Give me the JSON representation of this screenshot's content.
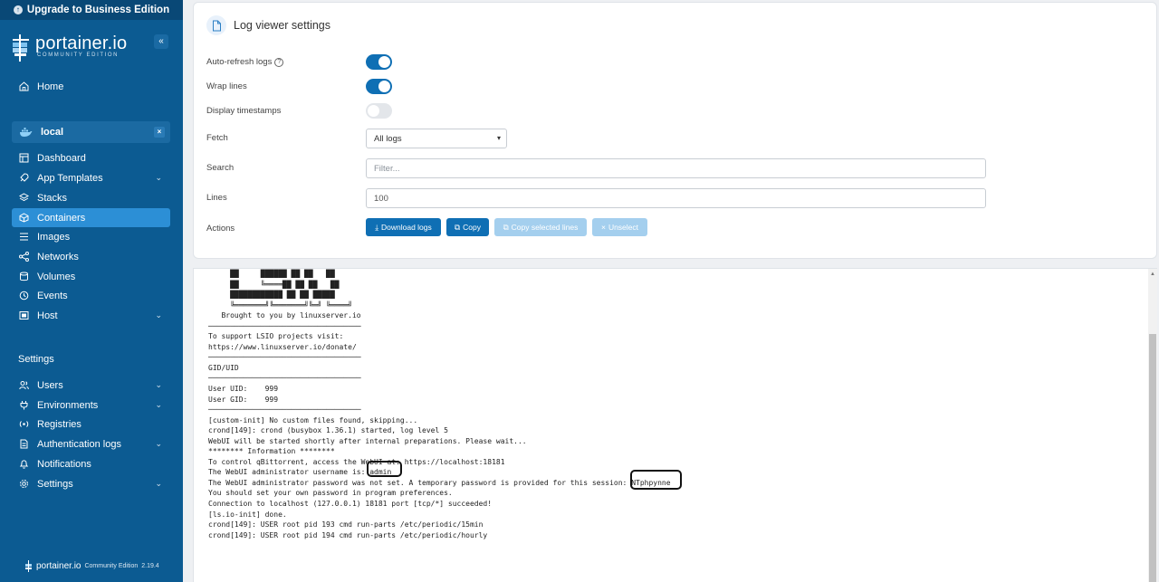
{
  "upgrade": {
    "label": "Upgrade to Business Edition"
  },
  "brand": {
    "name": "portainer.io",
    "edition": "COMMUNITY EDITION",
    "collapse_glyph": "«"
  },
  "nav": {
    "home": "Home",
    "environment": "local",
    "env_close": "×",
    "items": [
      {
        "label": "Dashboard",
        "icon": "dashboard-icon"
      },
      {
        "label": "App Templates",
        "icon": "rocket-icon"
      },
      {
        "label": "Stacks",
        "icon": "stack-icon"
      },
      {
        "label": "Containers",
        "icon": "box-icon"
      },
      {
        "label": "Images",
        "icon": "list-icon"
      },
      {
        "label": "Networks",
        "icon": "network-icon"
      },
      {
        "label": "Volumes",
        "icon": "database-icon"
      },
      {
        "label": "Events",
        "icon": "history-icon"
      },
      {
        "label": "Host",
        "icon": "server-icon"
      }
    ],
    "settings_header": "Settings",
    "settings_items": [
      {
        "label": "Users",
        "icon": "users-icon"
      },
      {
        "label": "Environments",
        "icon": "plug-icon"
      },
      {
        "label": "Registries",
        "icon": "radio-icon"
      },
      {
        "label": "Authentication logs",
        "icon": "file-text-icon"
      },
      {
        "label": "Notifications",
        "icon": "bell-icon"
      },
      {
        "label": "Settings",
        "icon": "gear-icon"
      }
    ],
    "active": "Containers",
    "accent": "#2c8fd6",
    "bg": "#0c5b92"
  },
  "footer": {
    "brand": "portainer.io",
    "edition": "Community Edition",
    "version": "2.19.4"
  },
  "settings_card": {
    "title": "Log viewer settings",
    "auto_refresh_label": "Auto-refresh logs",
    "auto_refresh": true,
    "wrap_lines_label": "Wrap lines",
    "wrap_lines": true,
    "timestamps_label": "Display timestamps",
    "timestamps": false,
    "fetch_label": "Fetch",
    "fetch_value": "All logs",
    "search_label": "Search",
    "search_placeholder": "Filter...",
    "lines_label": "Lines",
    "lines_value": "100",
    "actions_label": "Actions",
    "buttons": {
      "download": "Download logs",
      "copy": "Copy",
      "copy_selected": "Copy selected lines",
      "unselect": "Unselect"
    }
  },
  "log": {
    "lines": [
      "     ██     ██████ ██ ██   ██",
      "     ██     ╚════██ ██ ██   ██",
      "     ████████████ ██ ██ █████",
      "     ╚═══════╝╚═══════╝╚═╝ ╚════╝",
      "   Brought to you by linuxserver.io",
      "───────────────────────────────────",
      "To support LSIO projects visit:",
      "https://www.linuxserver.io/donate/",
      "───────────────────────────────────",
      "GID/UID",
      "───────────────────────────────────",
      "User UID:    999",
      "User GID:    999",
      "───────────────────────────────────",
      "[custom-init] No custom files found, skipping...",
      "crond[149]: crond (busybox 1.36.1) started, log level 5",
      "WebUI will be started shortly after internal preparations. Please wait...",
      "******** Information ********",
      "To control qBittorrent, access the WebUI at: https://localhost:18181",
      "The WebUI administrator username is: admin",
      "The WebUI administrator password was not set. A temporary password is provided for this session: NTphpynne",
      "You should set your own password in program preferences.",
      "Connection to localhost (127.0.0.1) 18181 port [tcp/*] succeeded!",
      "[ls.io-init] done.",
      "crond[149]: USER root pid 193 cmd run-parts /etc/periodic/15min",
      "crond[149]: USER root pid 194 cmd run-parts /etc/periodic/hourly"
    ]
  }
}
